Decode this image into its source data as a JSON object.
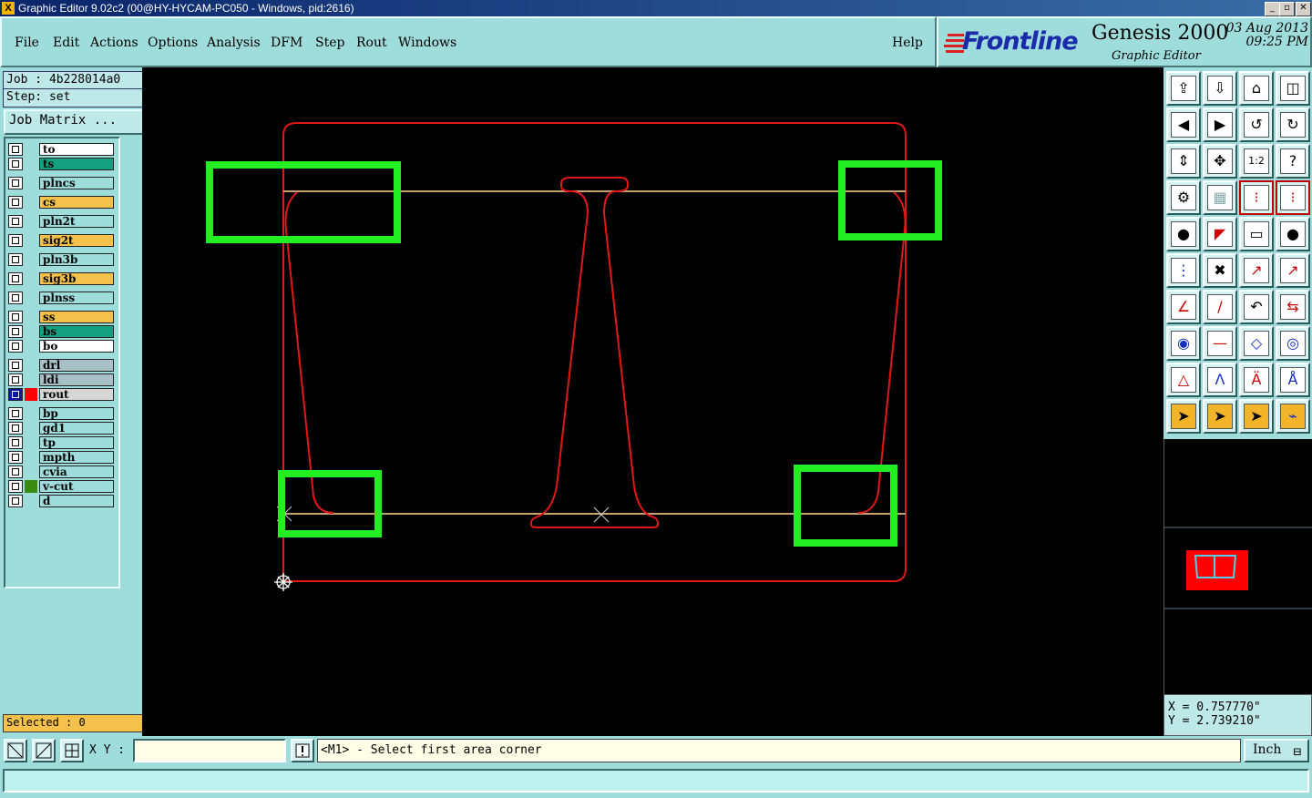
{
  "window": {
    "title": "Graphic Editor 9.02c2 (00@HY-HYCAM-PC050 - Windows, pid:2616)",
    "buttons": [
      "_",
      "▫",
      "✕"
    ]
  },
  "menu": {
    "items": [
      "File",
      "Edit",
      "Actions",
      "Options",
      "Analysis",
      "DFM",
      "Step",
      "Rout",
      "Windows"
    ],
    "help": "Help"
  },
  "brand": {
    "logo": "Frontline",
    "product": "Genesis 2000",
    "subtitle": "Graphic Editor",
    "date": "03 Aug 2013",
    "time": "09:25 PM"
  },
  "job": {
    "job_label": "Job : 4b228014a0",
    "step_label": "Step: set",
    "matrix_button": "Job Matrix ..."
  },
  "layers": [
    {
      "name": "to",
      "color": "#ffffff"
    },
    {
      "name": "ts",
      "color": "#13a07e"
    },
    {
      "name": "plncs",
      "color": "#9fdcdc"
    },
    {
      "name": "cs",
      "color": "#f4c24a"
    },
    {
      "name": "pln2t",
      "color": "#9fdcdc"
    },
    {
      "name": "sig2t",
      "color": "#f4c24a"
    },
    {
      "name": "pln3b",
      "color": "#9fdcdc"
    },
    {
      "name": "sig3b",
      "color": "#f4c24a"
    },
    {
      "name": "plnss",
      "color": "#9fdcdc"
    },
    {
      "name": "ss",
      "color": "#f4c24a"
    },
    {
      "name": "bs",
      "color": "#13a07e"
    },
    {
      "name": "bo",
      "color": "#ffffff"
    },
    {
      "name": "drl",
      "color": "#a7c0c8"
    },
    {
      "name": "ldi",
      "color": "#a7c0c8"
    },
    {
      "name": "rout",
      "color": "#d6d6d6",
      "active": true,
      "swatch": "#ff0000"
    },
    {
      "name": "bp",
      "color": "#9fdcdc"
    },
    {
      "name": "gd1",
      "color": "#9fdcdc"
    },
    {
      "name": "tp",
      "color": "#9fdcdc"
    },
    {
      "name": "mpth",
      "color": "#9fdcdc"
    },
    {
      "name": "cvia",
      "color": "#9fdcdc"
    },
    {
      "name": "v-cut",
      "color": "#9fdcdc",
      "swatch": "#3a8a10"
    },
    {
      "name": "d",
      "color": "#9fdcdc"
    }
  ],
  "selection": {
    "selected_label": "Selected : 0"
  },
  "coords": {
    "x": "X = 0.757770\"",
    "y": "Y = 2.739210\""
  },
  "bottom": {
    "xy_label": "X Y :",
    "xy_value": "",
    "prompt": "<M1> - Select first area corner",
    "units": "Inch"
  },
  "colors": {
    "outline": "#e01818",
    "guide": "#c8a070",
    "highlight": "#22ee22",
    "canvas": "#000000"
  }
}
